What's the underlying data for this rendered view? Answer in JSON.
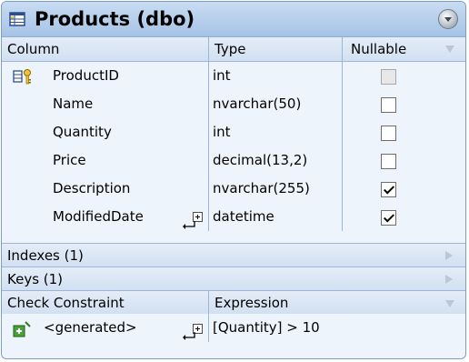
{
  "title": "Products (dbo)",
  "columns_header": {
    "column": "Column",
    "type": "Type",
    "nullable": "Nullable"
  },
  "rows": [
    {
      "name": "ProductID",
      "type": "int",
      "nullable": false,
      "key": true
    },
    {
      "name": "Name",
      "type": "nvarchar(50)",
      "nullable": false
    },
    {
      "name": "Quantity",
      "type": "int",
      "nullable": false
    },
    {
      "name": "Price",
      "type": "decimal(13,2)",
      "nullable": false
    },
    {
      "name": "Description",
      "type": "nvarchar(255)",
      "nullable": true
    },
    {
      "name": "ModifiedDate",
      "type": "datetime",
      "nullable": true
    }
  ],
  "indexes_label": "Indexes (1)",
  "keys_label": "Keys (1)",
  "check_header": {
    "constraint": "Check Constraint",
    "expression": "Expression"
  },
  "check_row": {
    "name": "<generated>",
    "expression": "[Quantity] > 10"
  },
  "icons": {
    "table": "table-icon",
    "key": "primary-key-icon",
    "collapse": "collapse-icon",
    "add": "add-constraint-icon"
  },
  "colors": {
    "frame_border": "#7a9cc6",
    "header_bg": "#d2e0f1",
    "body_bg": "#eef4fb"
  }
}
